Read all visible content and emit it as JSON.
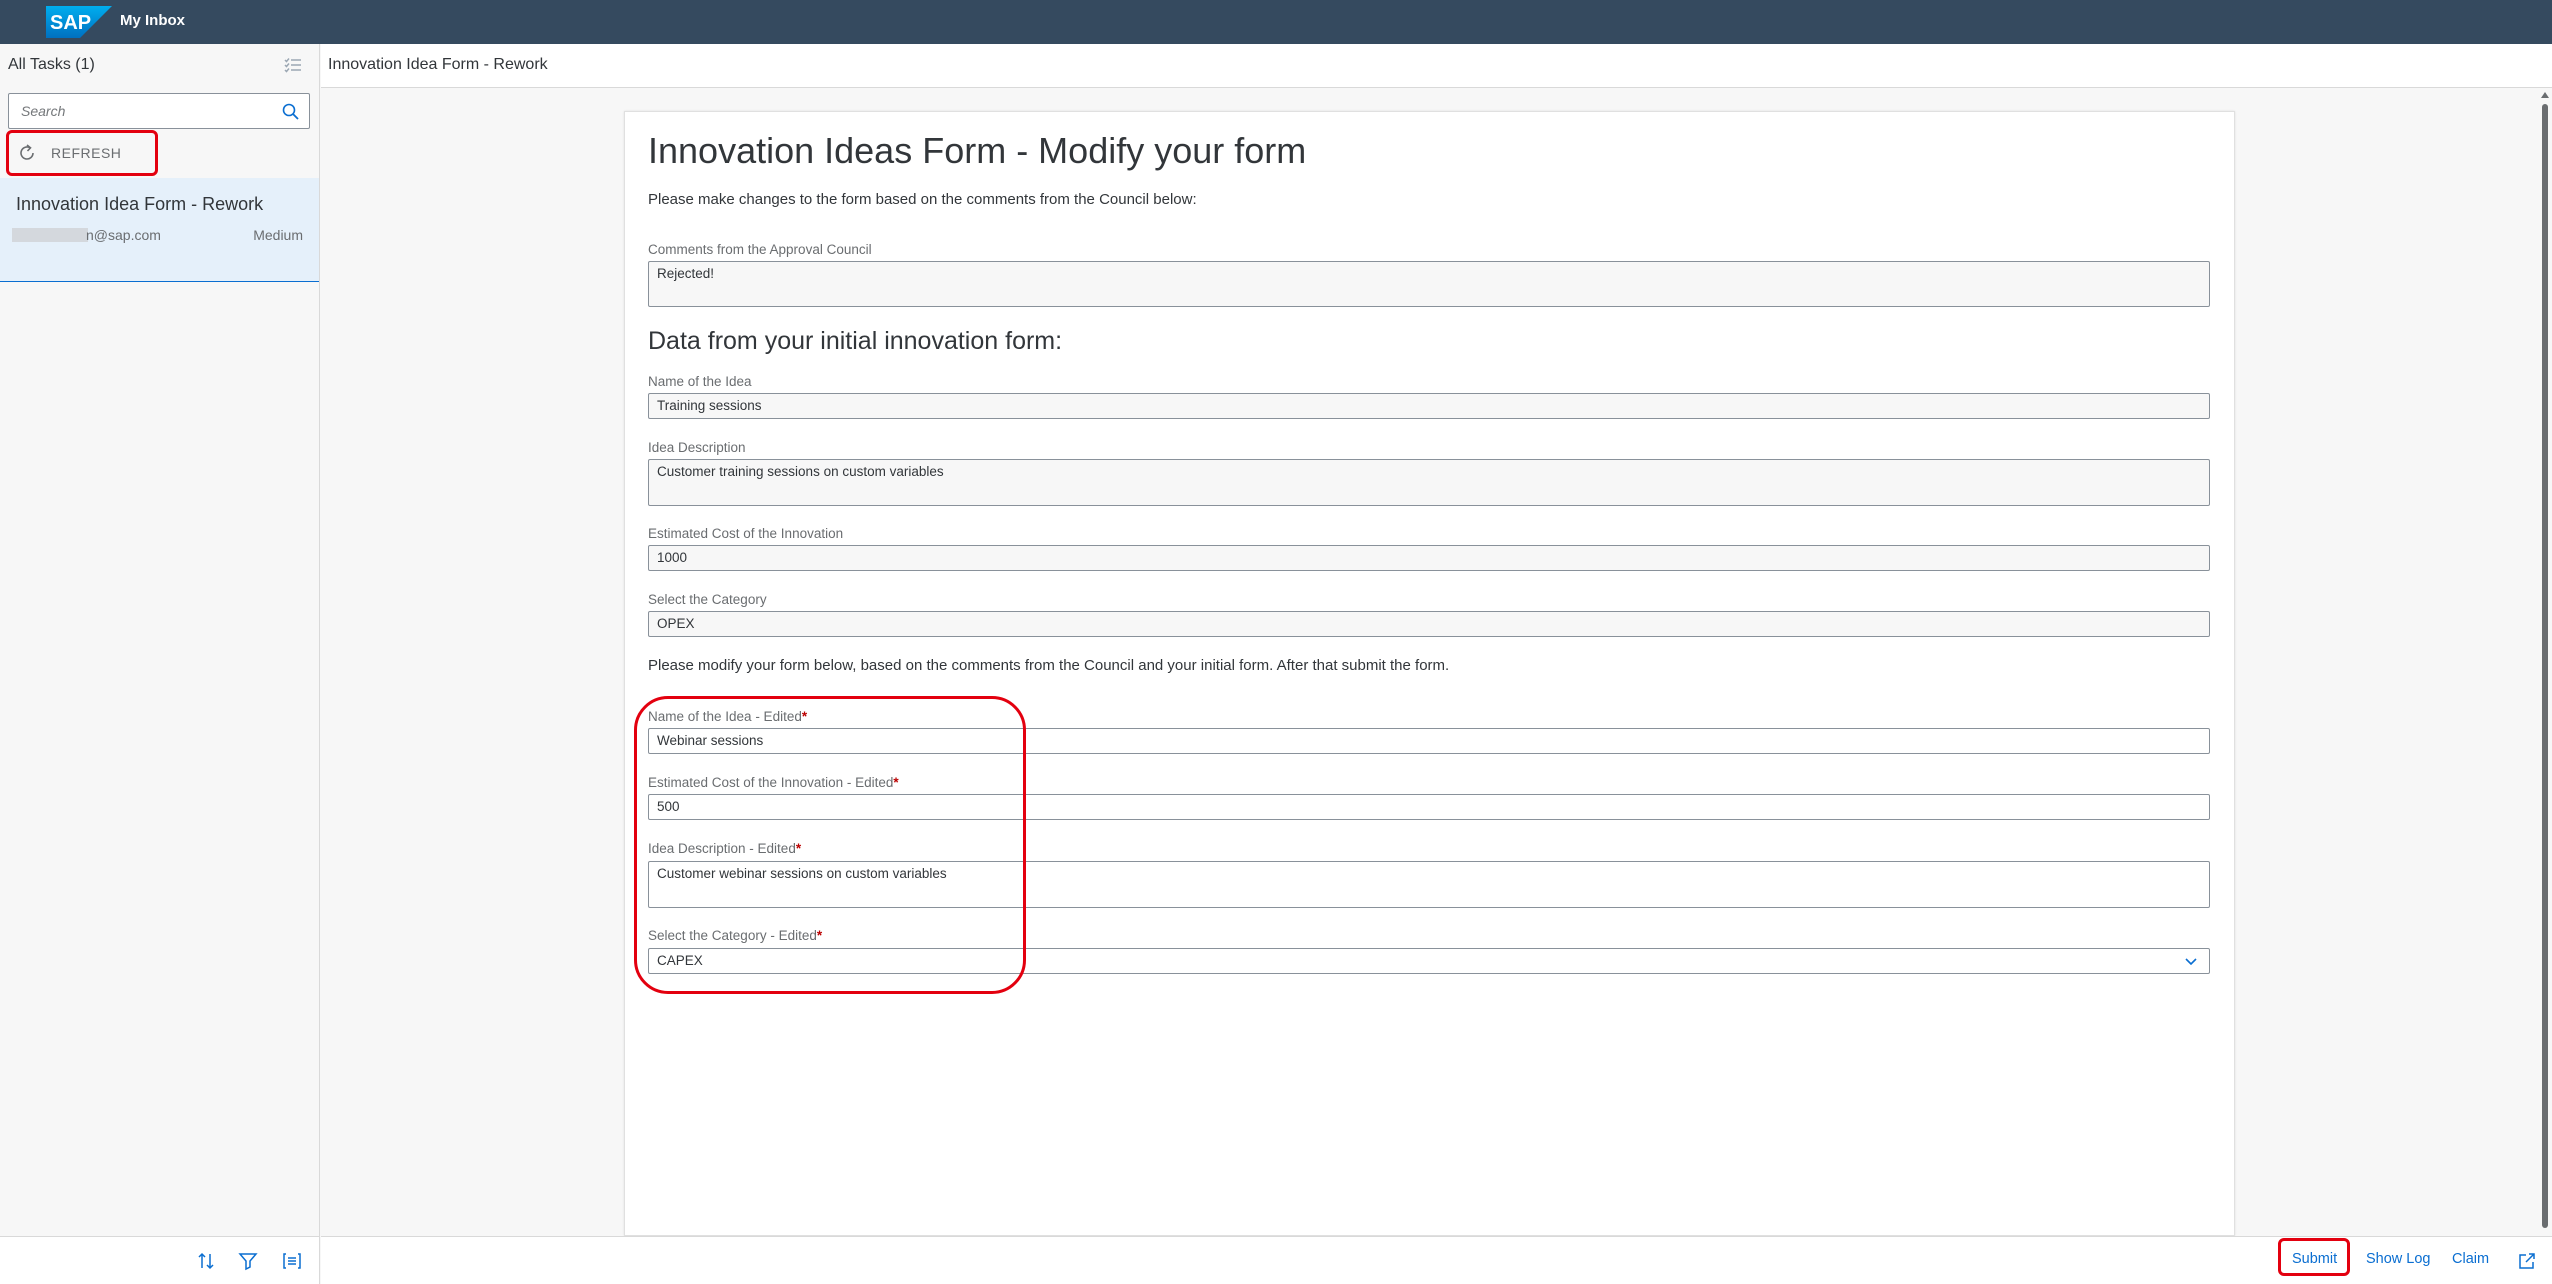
{
  "shell": {
    "logo_text": "SAP",
    "title": "My Inbox"
  },
  "master": {
    "header_title": "All Tasks (1)",
    "search_placeholder": "Search",
    "refresh_label": "REFRESH",
    "tasks": [
      {
        "title": "Innovation Idea Form - Rework",
        "email_suffix": "n@sap.com",
        "priority": "Medium"
      }
    ]
  },
  "detail": {
    "header_title": "Innovation Idea Form - Rework",
    "form": {
      "title": "Innovation Ideas Form - Modify your form",
      "intro": "Please make changes to the form based on the comments from the Council below:",
      "comments_label": "Comments from the Approval Council",
      "comments_value": "Rejected!",
      "section_title": "Data from your initial innovation form:",
      "name_label": "Name of the Idea",
      "name_value": "Training sessions",
      "desc_label": "Idea Description",
      "desc_value": "Customer training sessions on custom variables",
      "cost_label": "Estimated Cost of the Innovation",
      "cost_value": "1000",
      "category_label": "Select the Category",
      "category_value": "OPEX",
      "modify_text": "Please modify your form below, based on the comments from the Council and your initial form. After that submit the form.",
      "name_edited_label": "Name of the Idea - Edited",
      "name_edited_value": "Webinar sessions",
      "cost_edited_label": "Estimated Cost of the Innovation - Edited",
      "cost_edited_value": "500",
      "desc_edited_label": "Idea Description - Edited",
      "desc_edited_value": "Customer webinar sessions on custom variables",
      "category_edited_label": "Select the Category - Edited",
      "category_edited_value": "CAPEX",
      "required_marker": "*"
    },
    "footer": {
      "submit": "Submit",
      "show_log": "Show Log",
      "claim": "Claim"
    }
  },
  "colors": {
    "shell": "#354a5f",
    "accent": "#0a6ed1",
    "highlight": "#e3000f",
    "selected_item": "#e5f0fa"
  }
}
